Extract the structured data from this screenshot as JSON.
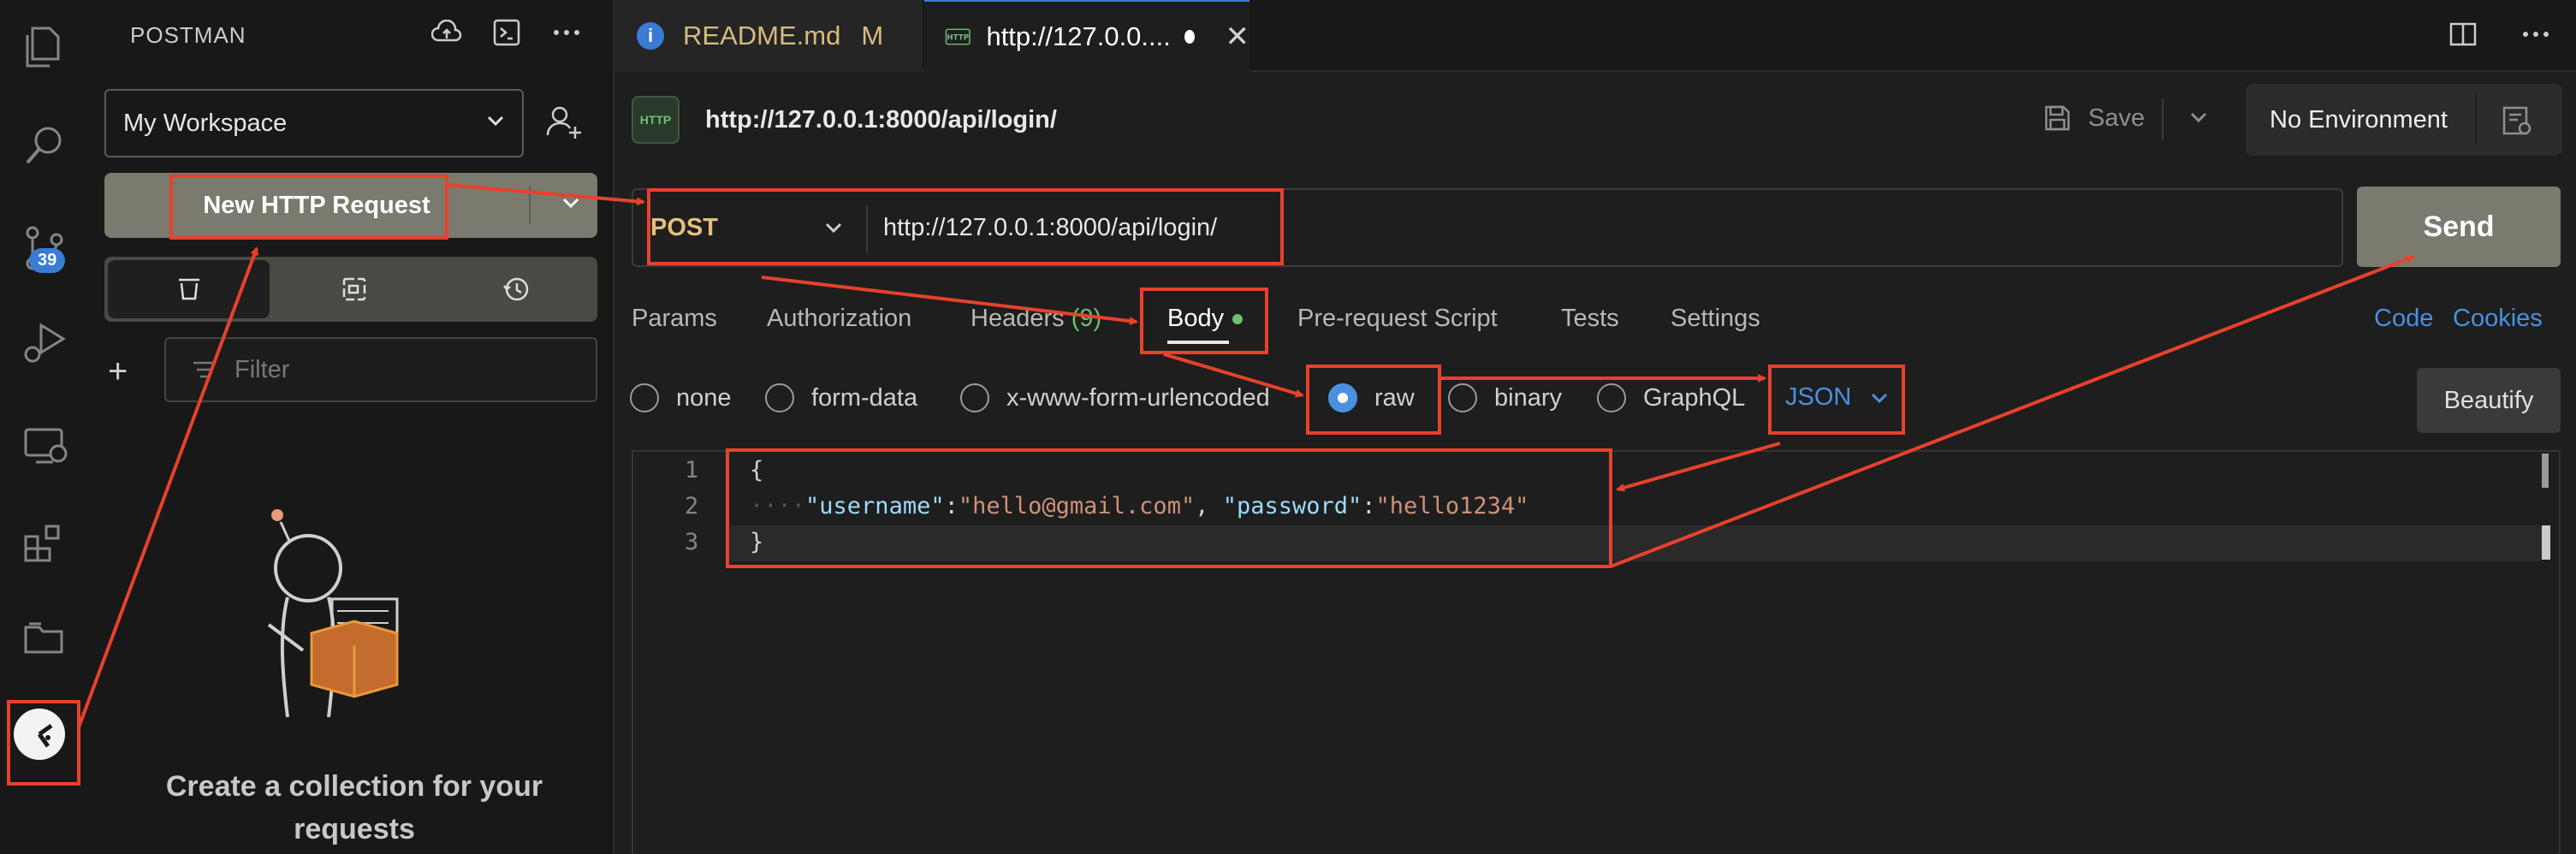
{
  "activity_bar": {
    "icons": [
      "files-icon",
      "search-icon",
      "source-control-icon",
      "run-debug-icon",
      "remote-explorer-icon",
      "extensions-icon",
      "folder-icon",
      "postman-icon"
    ],
    "source_control_badge": "39"
  },
  "sidebar": {
    "title": "POSTMAN",
    "workspace": "My Workspace",
    "new_request_label": "New HTTP Request",
    "filter_placeholder": "Filter",
    "empty_state": "Create a collection for your requests"
  },
  "tabs": [
    {
      "label": "README.md",
      "status": "M"
    },
    {
      "label": "http://127.0.0...."
    }
  ],
  "request": {
    "title": "http://127.0.0.1:8000/api/login/",
    "save_label": "Save",
    "environment": "No Environment",
    "method": "POST",
    "url": "http://127.0.0.1:8000/api/login/",
    "send_label": "Send"
  },
  "request_tabs": {
    "params": "Params",
    "authorization": "Authorization",
    "headers": "Headers",
    "headers_count": "(9)",
    "body": "Body",
    "pre_request": "Pre-request Script",
    "tests": "Tests",
    "settings": "Settings",
    "code": "Code",
    "cookies": "Cookies"
  },
  "body_types": {
    "none": "none",
    "form_data": "form-data",
    "urlencoded": "x-www-form-urlencoded",
    "raw": "raw",
    "binary": "binary",
    "graphql": "GraphQL",
    "selected": "raw",
    "format": "JSON",
    "beautify_label": "Beautify"
  },
  "editor": {
    "line_numbers": [
      "1",
      "2",
      "3"
    ],
    "lines": {
      "open": "{",
      "indent": "····",
      "key1": "\"username\"",
      "val1": "\"hello@gmail.com\"",
      "key2": "\"password\"",
      "val2": "\"hello1234\"",
      "close": "}"
    }
  },
  "colors": {
    "annotation": "#e8412c",
    "accent": "#4a90e2",
    "method": "#e5c07b"
  }
}
